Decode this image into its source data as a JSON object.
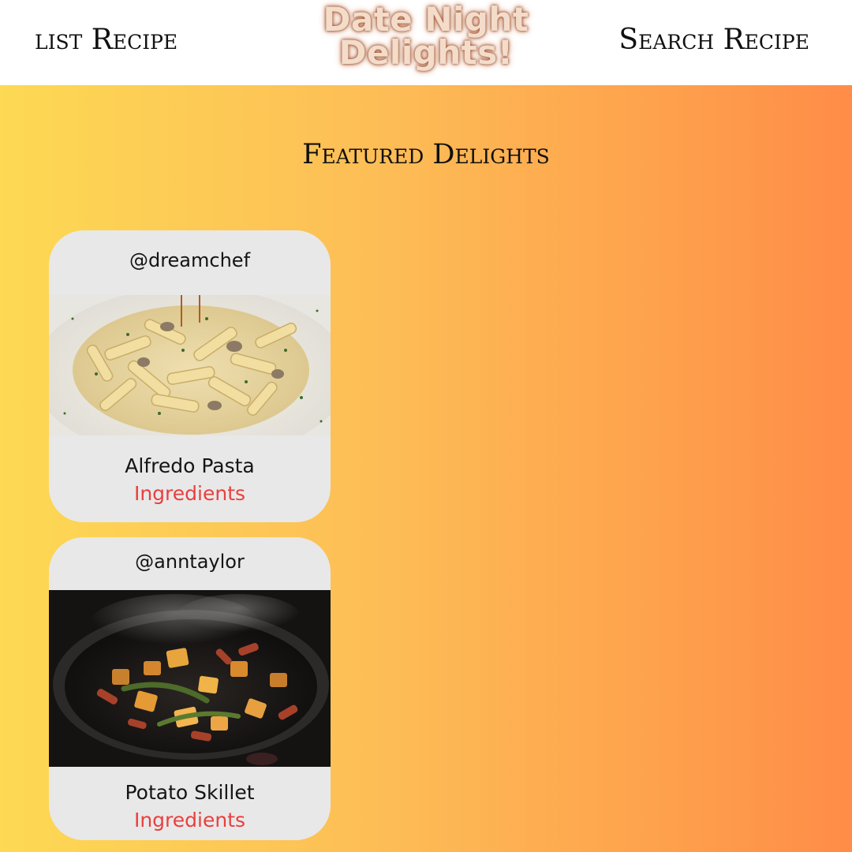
{
  "header": {
    "nav_left_label": "list Recipe",
    "nav_right_label": "Search Recipe",
    "logo_line1": "Date Night",
    "logo_line2": "Delights!"
  },
  "main": {
    "section_title": "Featured Delights"
  },
  "recipes": [
    {
      "user": "@dreamchef",
      "name": "Alfredo Pasta",
      "link_label": "Ingredients",
      "photo": "penne-alfredo-photo"
    },
    {
      "user": "@anntaylor",
      "name": "Potato Skillet",
      "link_label": "Ingredients",
      "photo": "potato-skillet-photo"
    }
  ],
  "colors": {
    "link": "#e8403f",
    "card_bg": "#e9e8e8",
    "gradient_start": "#fdd954",
    "gradient_end": "#ff8c48"
  }
}
